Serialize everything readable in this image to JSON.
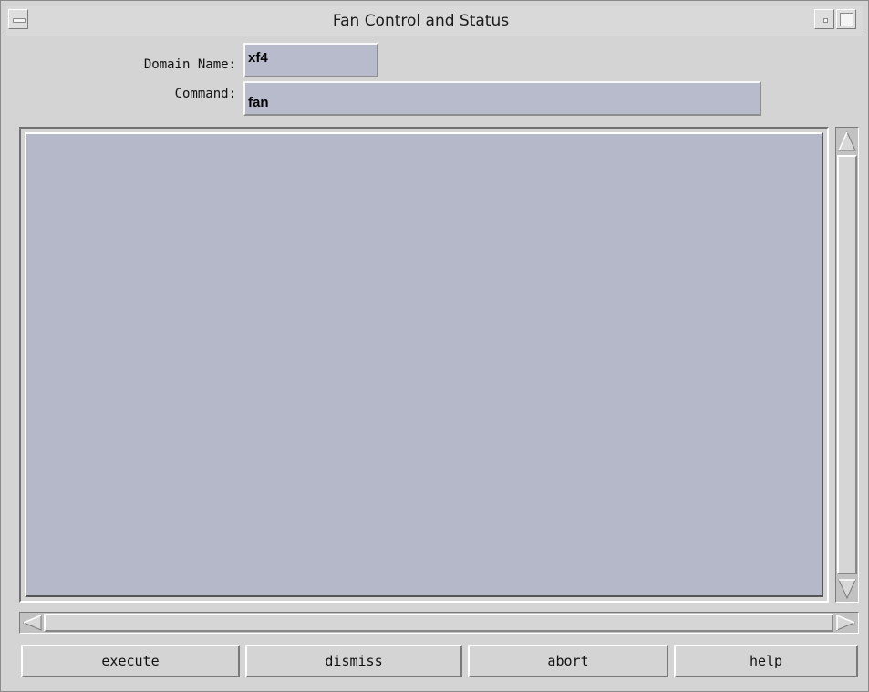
{
  "window": {
    "title": "Fan Control and Status"
  },
  "form": {
    "domain_label": "Domain Name:",
    "domain_value": "xf4",
    "command_label": "Command:",
    "command_value": "fan"
  },
  "output": {
    "text": ""
  },
  "buttons": {
    "execute": "execute",
    "dismiss": "dismiss",
    "abort": "abort",
    "help": "help"
  },
  "icons": [
    "window-menu-icon",
    "minimize-icon",
    "maximize-icon",
    "scroll-up-arrow-icon",
    "scroll-down-arrow-icon",
    "scroll-left-arrow-icon",
    "scroll-right-arrow-icon"
  ],
  "colors": {
    "field_bg": "#b7bbcc",
    "window_bg": "#d4d4d4"
  }
}
